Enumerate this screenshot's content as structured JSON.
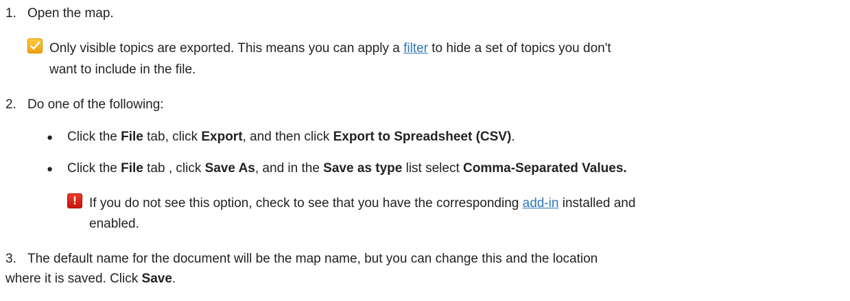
{
  "steps": [
    {
      "number": "1.",
      "text": "Open the map."
    },
    {
      "number": "2.",
      "text": "Do one of the following:"
    },
    {
      "number": "3.",
      "text_line1": "The default name for the document will be the map name, but you can change this and the location",
      "text_line2_pre": "where it is saved. Click ",
      "text_line2_bold": "Save",
      "text_line2_post": "."
    }
  ],
  "tip": {
    "icon": "checkmark-icon",
    "line1_pre": "Only visible topics are exported. This means you can apply a ",
    "line1_link": "filter",
    "line1_post": " to hide a set of topics you don't",
    "line2": "want to include in the file."
  },
  "bullets": [
    {
      "p1": "Click the ",
      "b1": "File",
      "p2": " tab, click ",
      "b2": "Export",
      "p3": ", and then click ",
      "b3": "Export to Spreadsheet (CSV)",
      "p4": "."
    },
    {
      "p1": "Click the ",
      "b1": "File",
      "p2": " tab , click ",
      "b2": "Save As",
      "p3": ", and in the ",
      "b3": "Save as type",
      "p4": " list select ",
      "b4": "Comma-Separated Values."
    }
  ],
  "warning": {
    "icon": "exclamation-icon",
    "glyph": "!",
    "line1_pre": "If you do not see this option, check to see that you have the corresponding ",
    "line1_link": "add-in",
    "line1_post": " installed and",
    "line2": "enabled."
  },
  "colors": {
    "link": "#2e75b6",
    "tip_icon": "#f5b021",
    "warning_icon": "#d9261a"
  }
}
